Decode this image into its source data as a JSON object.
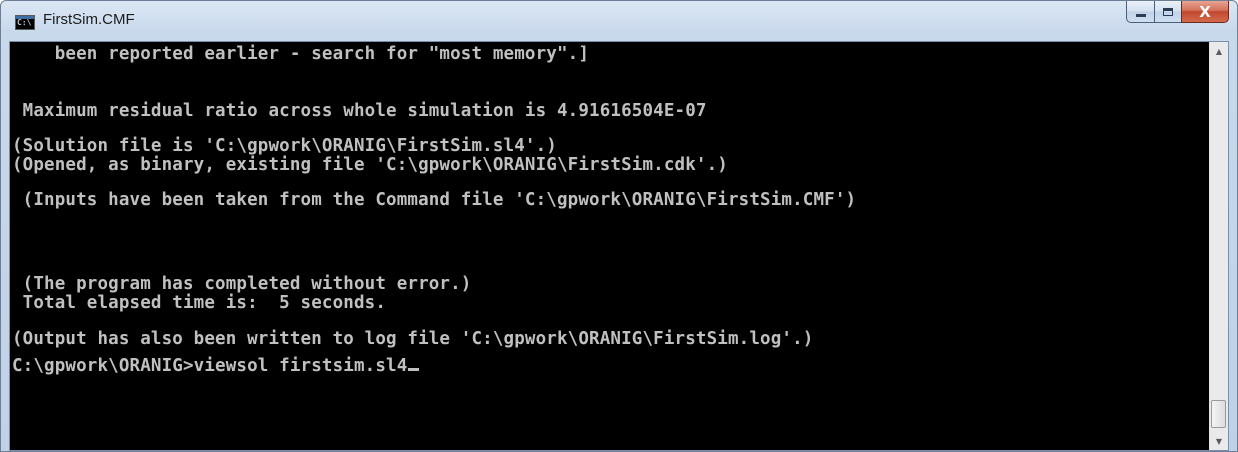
{
  "window": {
    "title": "FirstSim.CMF",
    "icon": "console-icon",
    "close_symbol": "X"
  },
  "console": {
    "lines": [
      "    been reported earlier - search for \"most memory\".]",
      "",
      " Maximum residual ratio across whole simulation is 4.91616504E-07",
      "(Solution file is 'C:\\gpwork\\ORANIG\\FirstSim.sl4'.)",
      "(Opened, as binary, existing file 'C:\\gpwork\\ORANIG\\FirstSim.cdk'.)",
      " (Inputs have been taken from the Command file 'C:\\gpwork\\ORANIG\\FirstSim.CMF')",
      " (The program has completed without error.)",
      " Total elapsed time is:  5 seconds.",
      "(Output has also been written to log file 'C:\\gpwork\\ORANIG\\FirstSim.log'.)",
      "C:\\gpwork\\ORANIG>viewsol firstsim.sl4"
    ],
    "foreground": "#c0c0c0",
    "background": "#000000"
  },
  "scrollbar": {
    "up_icon": "▲",
    "down_icon": "▼"
  }
}
